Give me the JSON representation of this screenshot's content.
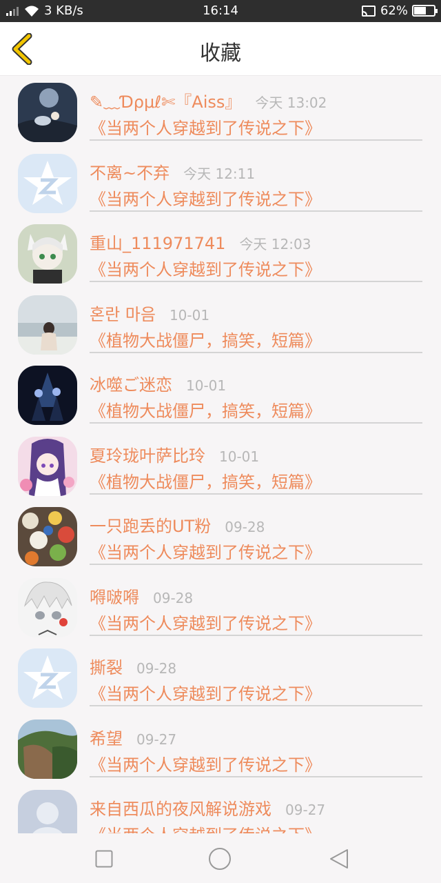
{
  "status_bar": {
    "network_speed": "3 KB/s",
    "time": "16:14",
    "battery": "62%",
    "battery_level": 0.62
  },
  "header": {
    "title": "收藏"
  },
  "list": [
    {
      "name": "✎﹏Ɗρμℓ✄『Aiss』",
      "date": "今天 13:02",
      "story": "《当两个人穿越到了传说之下》"
    },
    {
      "name": "不离~不弃",
      "date": "今天 12:11",
      "story": "《当两个人穿越到了传说之下》"
    },
    {
      "name": "重山_111971741",
      "date": "今天 12:03",
      "story": "《当两个人穿越到了传说之下》"
    },
    {
      "name": "혼란 마음",
      "date": "10-01",
      "story": "《植物大战僵尸，搞笑，短篇》"
    },
    {
      "name": "冰噬ご迷恋",
      "date": "10-01",
      "story": "《植物大战僵尸，搞笑，短篇》"
    },
    {
      "name": "夏玲珑叶萨比玲",
      "date": "10-01",
      "story": "《植物大战僵尸，搞笑，短篇》"
    },
    {
      "name": "一只跑丢的UT粉",
      "date": "09-28",
      "story": "《当两个人穿越到了传说之下》"
    },
    {
      "name": "嘚啵嘚",
      "date": "09-28",
      "story": "《当两个人穿越到了传说之下》"
    },
    {
      "name": "撕裂",
      "date": "09-28",
      "story": "《当两个人穿越到了传说之下》"
    },
    {
      "name": "希望",
      "date": "09-27",
      "story": "《当两个人穿越到了传说之下》"
    },
    {
      "name": "来自西瓜的夜风解说游戏",
      "date": "09-27",
      "story": "《当两个人穿越到了传说之下》"
    }
  ],
  "colors": {
    "accent": "#ee8b5c",
    "date": "#b7b7b7",
    "back_icon": "#f2c500"
  },
  "icons": {
    "back": "back-arrow-icon",
    "nav": [
      "recent-apps-icon",
      "home-icon",
      "back-icon"
    ]
  }
}
